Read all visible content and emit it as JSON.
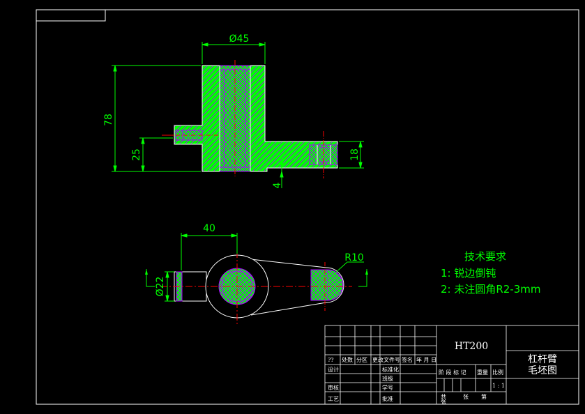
{
  "drawing": {
    "dimensions": {
      "dia45": "Ø45",
      "h78": "78",
      "h25": "25",
      "h18": "18",
      "surface": "4",
      "len40": "40",
      "dia22": "Ø22",
      "r10": "R10"
    },
    "notes": {
      "title": "技术要求",
      "line1": "1:  锐边倒钝",
      "line2": "2:  未注圆角R2-3mm"
    },
    "title_block": {
      "material": "HT200",
      "part_name_1": "杠杆臂",
      "part_name_2": "毛坯图",
      "rev_count": "??",
      "col_chuli": "处数",
      "col_fenqu": "分区",
      "col_gengai": "更改文件号",
      "col_qianming": "签名",
      "col_nianyue": "年 月 日",
      "row_sheji": "设计",
      "row_biaozhunhua": "标准化",
      "row_shenjiao": "审核",
      "row_gongyi": "工艺",
      "row_biaozhunhua2": "班级",
      "row_xuehao": "学号",
      "row_pizhun": "批准",
      "hdr_jieduan": "阶 段 标 记",
      "hdr_zhongliang": "重量",
      "hdr_bili": "比例",
      "scale": "1 : 1",
      "gong": "共",
      "zhang": "张",
      "di": "第",
      "zhang2": "张"
    }
  }
}
